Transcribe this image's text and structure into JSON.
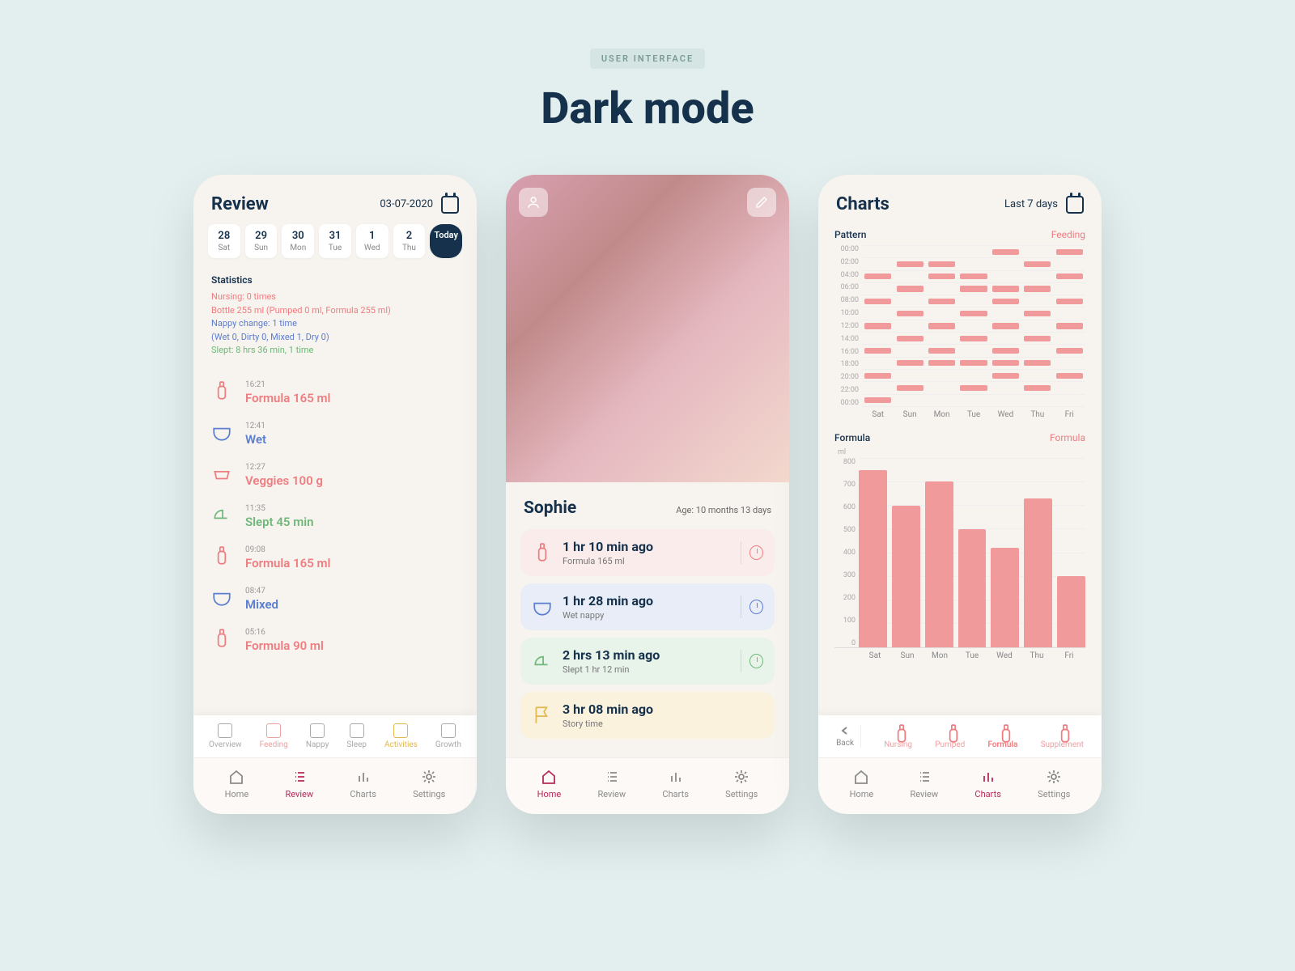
{
  "kicker": "USER INTERFACE",
  "title": "Dark mode",
  "review": {
    "heading": "Review",
    "date": "03-07-2020",
    "days": [
      {
        "num": "28",
        "dow": "Sat"
      },
      {
        "num": "29",
        "dow": "Sun"
      },
      {
        "num": "30",
        "dow": "Mon"
      },
      {
        "num": "31",
        "dow": "Tue"
      },
      {
        "num": "1",
        "dow": "Wed"
      },
      {
        "num": "2",
        "dow": "Thu"
      }
    ],
    "today": "Today",
    "stats_label": "Statistics",
    "stats": {
      "nursing": "Nursing: 0 times",
      "bottle": "Bottle 255 ml (Pumped 0 ml, Formula 255 ml)",
      "nappy": "Nappy change: 1 time",
      "nappy2": "(Wet 0, Dirty 0, Mixed 1, Dry 0)",
      "slept": "Slept: 8 hrs 36 min, 1 time"
    },
    "entries": [
      {
        "time": "16:21",
        "title": "Formula 165 ml",
        "icon": "bottle",
        "cls": "pink"
      },
      {
        "time": "12:41",
        "title": "Wet",
        "icon": "nappy",
        "cls": "blue"
      },
      {
        "time": "12:27",
        "title": "Veggies 100 g",
        "icon": "solid",
        "cls": "pink"
      },
      {
        "time": "11:35",
        "title": "Slept 45 min",
        "icon": "sleep",
        "cls": "green"
      },
      {
        "time": "09:08",
        "title": "Formula 165 ml",
        "icon": "bottle",
        "cls": "pink"
      },
      {
        "time": "08:47",
        "title": "Mixed",
        "icon": "nappy",
        "cls": "blue"
      },
      {
        "time": "05:16",
        "title": "Formula 90 ml",
        "icon": "bottle",
        "cls": "pink"
      }
    ],
    "subtabs": [
      "Overview",
      "Feeding",
      "Nappy",
      "Sleep",
      "Activities",
      "Growth"
    ],
    "subtabs_active": "Activities"
  },
  "home": {
    "name": "Sophie",
    "age": "Age: 10 months 13 days",
    "cards": [
      {
        "title": "1 hr 10 min ago",
        "sub": "Formula 165 ml",
        "icon": "bottle",
        "cls": "c-pink",
        "clock": "#ef7d80"
      },
      {
        "title": "1 hr 28 min ago",
        "sub": "Wet nappy",
        "icon": "nappy",
        "cls": "c-blue",
        "clock": "#5b7ed0"
      },
      {
        "title": "2 hrs 13 min ago",
        "sub": "Slept 1 hr 12 min",
        "icon": "sleep",
        "cls": "c-green",
        "clock": "#6fb87a"
      },
      {
        "title": "3 hr 08 min ago",
        "sub": "Story time",
        "icon": "flag",
        "cls": "c-yellow",
        "clock": ""
      }
    ]
  },
  "charts": {
    "heading": "Charts",
    "range": "Last 7 days",
    "pattern": {
      "name": "Pattern",
      "type": "Feeding",
      "hours": [
        "00:00",
        "02:00",
        "04:00",
        "06:00",
        "08:00",
        "10:00",
        "12:00",
        "14:00",
        "16:00",
        "18:00",
        "20:00",
        "22:00",
        "00:00"
      ],
      "xlabels": [
        "Sat",
        "Sun",
        "Mon",
        "Tue",
        "Wed",
        "Thu",
        "Fri"
      ]
    },
    "formula": {
      "name": "Formula",
      "type": "Formula",
      "unit": "ml",
      "yticks": [
        "800",
        "700",
        "600",
        "500",
        "400",
        "300",
        "200",
        "100",
        "0"
      ],
      "xlabels": [
        "Sat",
        "Sun",
        "Mon",
        "Tue",
        "Wed",
        "Thu",
        "Fri"
      ]
    },
    "subtabs": {
      "back": "Back",
      "items": [
        "Nursing",
        "Pumped",
        "Formula",
        "Supplement"
      ],
      "active": "Formula"
    }
  },
  "nav": [
    "Home",
    "Review",
    "Charts",
    "Settings"
  ],
  "chart_data": [
    {
      "type": "heatmap",
      "title": "Feeding pattern (hours with feeding events per day)",
      "x": [
        "Sat",
        "Sun",
        "Mon",
        "Tue",
        "Wed",
        "Thu",
        "Fri"
      ],
      "y": [
        "00:00",
        "02:00",
        "04:00",
        "06:00",
        "08:00",
        "10:00",
        "12:00",
        "14:00",
        "16:00",
        "18:00",
        "20:00",
        "22:00",
        "00:00"
      ],
      "on_cells": [
        [
          0,
          0,
          0,
          0,
          1,
          0,
          1
        ],
        [
          0,
          1,
          1,
          0,
          0,
          1,
          0
        ],
        [
          1,
          0,
          1,
          1,
          0,
          0,
          1
        ],
        [
          0,
          1,
          0,
          1,
          1,
          1,
          0
        ],
        [
          1,
          0,
          1,
          0,
          1,
          0,
          1
        ],
        [
          0,
          1,
          0,
          1,
          0,
          1,
          0
        ],
        [
          1,
          0,
          1,
          0,
          1,
          0,
          1
        ],
        [
          0,
          1,
          0,
          1,
          0,
          1,
          0
        ],
        [
          1,
          0,
          1,
          0,
          1,
          0,
          1
        ],
        [
          0,
          1,
          1,
          1,
          1,
          1,
          0
        ],
        [
          1,
          0,
          0,
          0,
          1,
          0,
          1
        ],
        [
          0,
          1,
          0,
          1,
          0,
          1,
          0
        ],
        [
          1,
          0,
          0,
          0,
          0,
          0,
          0
        ]
      ]
    },
    {
      "type": "bar",
      "title": "Formula",
      "ylabel": "ml",
      "ylim": [
        0,
        800
      ],
      "categories": [
        "Sat",
        "Sun",
        "Mon",
        "Tue",
        "Wed",
        "Thu",
        "Fri"
      ],
      "values": [
        750,
        600,
        700,
        500,
        420,
        630,
        300
      ]
    }
  ]
}
